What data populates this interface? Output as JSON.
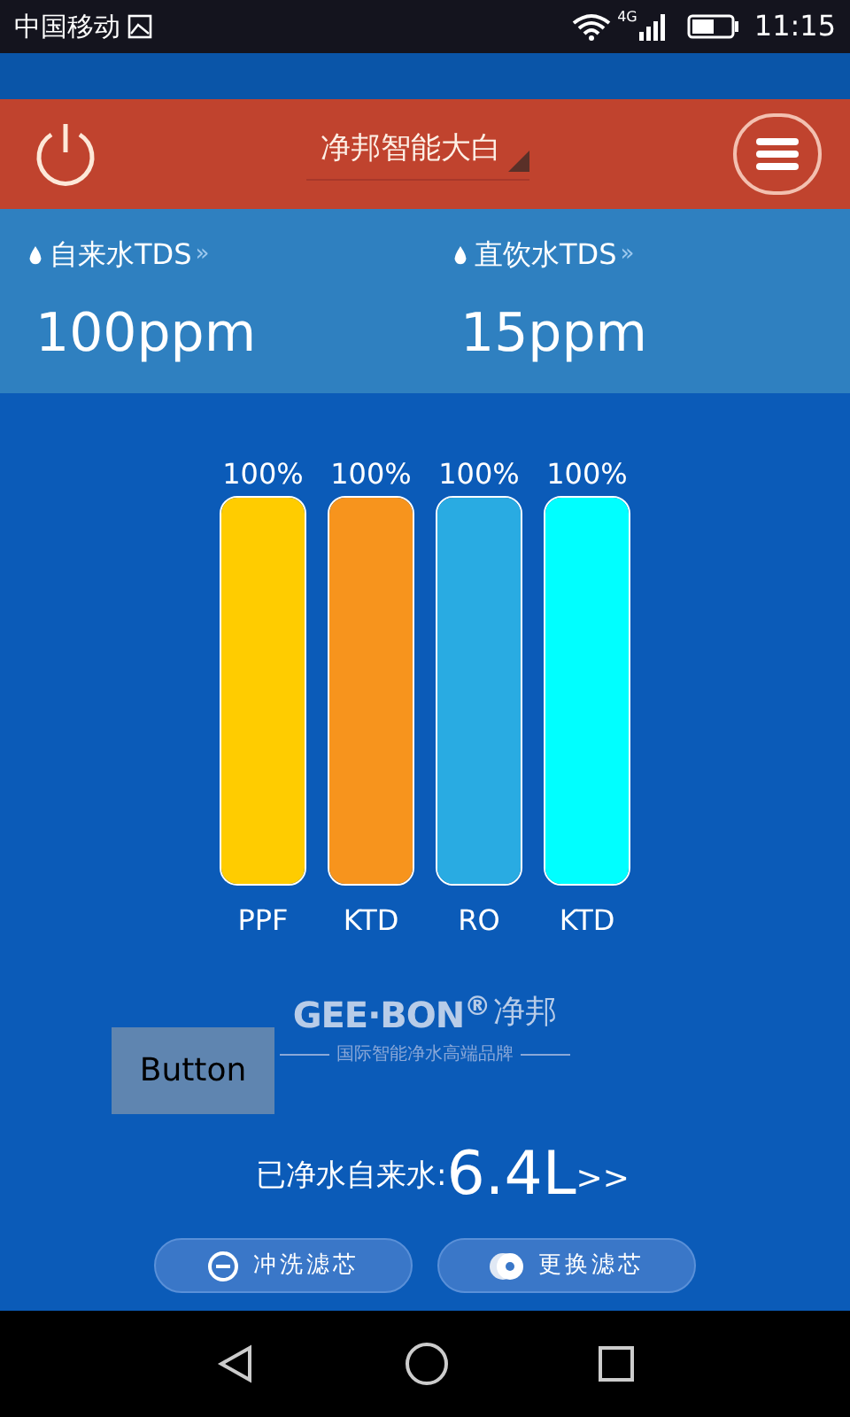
{
  "status_bar": {
    "carrier": "中国移动",
    "network": "4G",
    "time": "11:15"
  },
  "header": {
    "title": "净邦智能大白"
  },
  "tds": [
    {
      "label": "自来水TDS",
      "arrow": "»",
      "value": "100ppm"
    },
    {
      "label": "直饮水TDS",
      "arrow": "»",
      "value": "15ppm"
    }
  ],
  "filters": [
    {
      "name": "PPF",
      "percent": "100%",
      "level": 1,
      "color": "#ffcc00"
    },
    {
      "name": "KTD",
      "percent": "100%",
      "level": 1,
      "color": "#f7941d"
    },
    {
      "name": "RO",
      "percent": "100%",
      "level": 1,
      "color": "#29abe2"
    },
    {
      "name": "KTD",
      "percent": "100%",
      "level": 1,
      "color": "#00ffff"
    }
  ],
  "logo": {
    "brand": "GEE·BON$^{®}$",
    "chinese": "净邦",
    "tagline": "国际智能净水高端品牌"
  },
  "button": {
    "label": "Button"
  },
  "purified": {
    "label": "已净水自来水:",
    "value": "6.4L",
    "arrow": ">>"
  },
  "actions": [
    {
      "kind": "flush",
      "label": "冲洗滤芯"
    },
    {
      "kind": "replace",
      "label": "更换滤芯"
    }
  ]
}
